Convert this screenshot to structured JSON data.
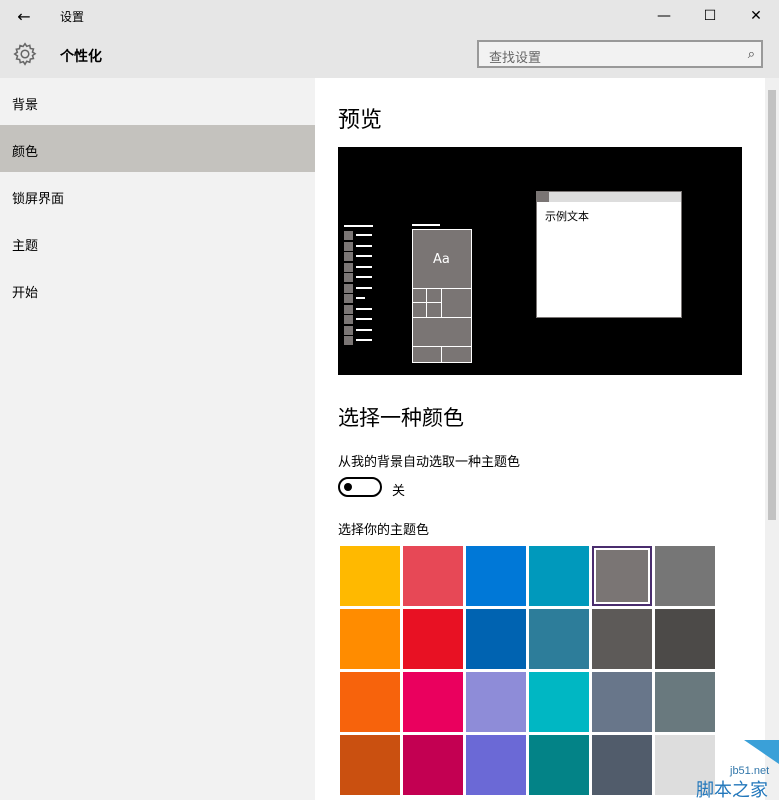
{
  "window": {
    "title": "设置",
    "back_icon": "←",
    "min_icon": "—",
    "max_icon": "☐",
    "close_icon": "✕"
  },
  "header": {
    "page_title": "个性化",
    "search_placeholder": "查找设置",
    "search_icon": "⌕"
  },
  "sidebar": {
    "items": [
      {
        "label": "背景",
        "selected": false
      },
      {
        "label": "颜色",
        "selected": true
      },
      {
        "label": "锁屏界面",
        "selected": false
      },
      {
        "label": "主题",
        "selected": false
      },
      {
        "label": "开始",
        "selected": false
      }
    ]
  },
  "preview": {
    "heading": "预览",
    "tile_label": "Aa",
    "window_text": "示例文本"
  },
  "color": {
    "heading": "选择一种颜色",
    "auto_label": "从我的背景自动选取一种主题色",
    "toggle_state": "关",
    "accent_label": "选择你的主题色",
    "swatches": [
      "#FFB900",
      "#E74856",
      "#0078D7",
      "#0099BC",
      "#7A7574",
      "#767676",
      "#FF8C00",
      "#E81123",
      "#0063B1",
      "#2D7D9A",
      "#5D5A58",
      "#4C4A48",
      "#F7630C",
      "#EA005E",
      "#8E8CD8",
      "#00B7C3",
      "#68768A",
      "#69797E",
      "#CA5010",
      "#C30052",
      "#6B69D6",
      "#038387",
      "#515C6B",
      "#DDDDDD"
    ],
    "selected_index": 4
  },
  "watermark": {
    "site": "jb51.net",
    "name": "脚本之家"
  }
}
